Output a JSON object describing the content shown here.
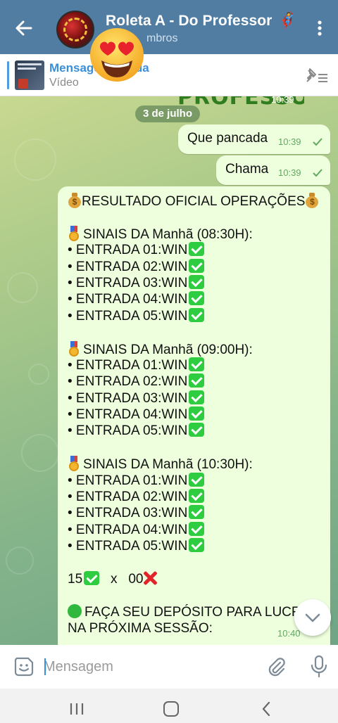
{
  "header": {
    "title": "Roleta A - Do Professor",
    "title_emoji": "🦸",
    "subtitle": "mbros",
    "avatar_overlay_emoji": "😍",
    "icons": {
      "back": "arrow-left-icon",
      "menu": "kebab-menu-icon"
    }
  },
  "pinned": {
    "title": "Mensagem fixada",
    "subtitle": "Vídeo"
  },
  "chat": {
    "date": "3 de julho",
    "banner_fragment": "PROFESSOR",
    "banner_time": "10:39",
    "outgoing": [
      {
        "text": "Que pancada",
        "time": "10:39"
      },
      {
        "text": "Chama",
        "time": "10:39"
      }
    ],
    "message": {
      "title": "RESULTADO OFICIAL OPERAÇÕES",
      "sessions": [
        {
          "heading": "SINAIS DA Manhã (08:30H):",
          "entries": [
            "• ENTRADA 01:WIN",
            "• ENTRADA 02:WIN",
            "• ENTRADA 03:WIN",
            "• ENTRADA 04:WIN",
            "• ENTRADA 05:WIN"
          ]
        },
        {
          "heading": "SINAIS DA Manhã (09:00H):",
          "entries": [
            "• ENTRADA 01:WIN",
            "• ENTRADA 02:WIN",
            "• ENTRADA 03:WIN",
            "• ENTRADA 04:WIN",
            "• ENTRADA 05:WIN"
          ]
        },
        {
          "heading": "SINAIS DA Manhã (10:30H):",
          "entries": [
            "• ENTRADA 01:WIN",
            "• ENTRADA 02:WIN",
            "• ENTRADA 03:WIN",
            "• ENTRADA 04:WIN",
            "• ENTRADA 05:WIN"
          ]
        }
      ],
      "score_wins": "15",
      "score_sep": "x",
      "score_losses": "00",
      "cta_line1": "FAÇA SEU DEPÓSITO PARA LUCRAR",
      "cta_line2": "NA PRÓXIMA SESSÃO:",
      "time": "10:40"
    }
  },
  "input": {
    "placeholder": "Mensagem",
    "icons": {
      "emoji": "sticker-emoji-icon",
      "attach": "paperclip-icon",
      "mic": "microphone-icon"
    }
  },
  "colors": {
    "header": "#517da2",
    "bubble": "#eeffde",
    "time": "#61a961",
    "link": "#3a8fd9",
    "check_emoji": "#2ecc40",
    "cross": "#e0242a"
  }
}
